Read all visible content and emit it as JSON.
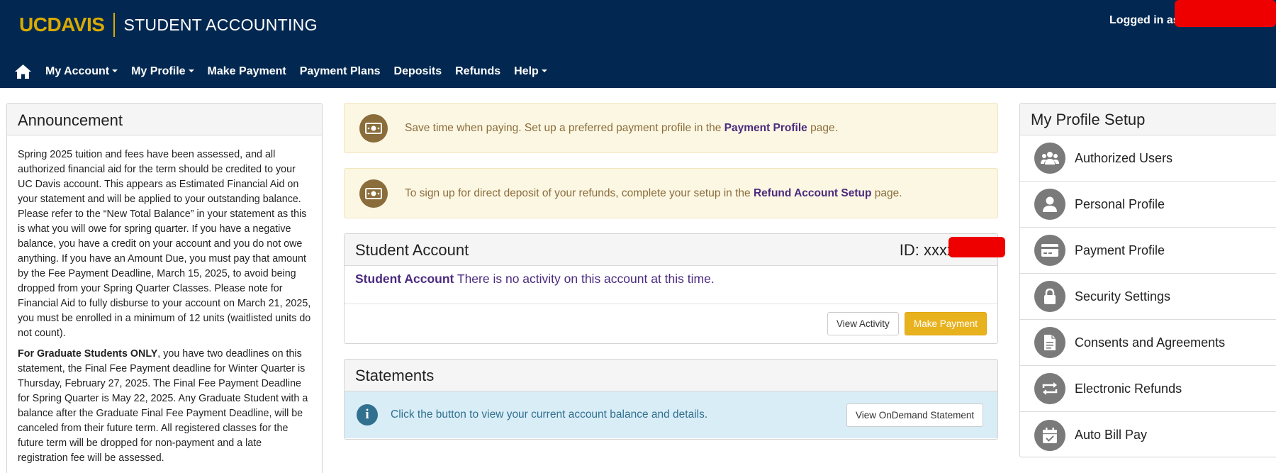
{
  "header": {
    "logo_text": "UCDAVIS",
    "app_title": "STUDENT ACCOUNTING",
    "login_text": "Logged in as"
  },
  "nav": {
    "items": [
      {
        "label": "My Account",
        "dropdown": true
      },
      {
        "label": "My Profile",
        "dropdown": true
      },
      {
        "label": "Make Payment",
        "dropdown": false
      },
      {
        "label": "Payment Plans",
        "dropdown": false
      },
      {
        "label": "Deposits",
        "dropdown": false
      },
      {
        "label": "Refunds",
        "dropdown": false
      },
      {
        "label": "Help",
        "dropdown": true
      }
    ]
  },
  "announcement": {
    "title": "Announcement",
    "p1": "Spring 2025 tuition and fees have been assessed, and all authorized financial aid for the term should be credited to your UC Davis account. This appears as Estimated Financial Aid on your statement and will be applied to your outstanding balance. Please refer to the “New Total Balance” in your statement as this is what you will owe for spring quarter. If you have a negative balance, you have a credit on your account and you do not owe anything. If you have an Amount Due, you must pay that amount by the Fee Payment Deadline, March 15, 2025, to avoid being dropped from your Spring Quarter Classes. Please note for Financial Aid to fully disburse to your account on March 21, 2025, you must be enrolled in a minimum of 12 units (waitlisted units do not count).",
    "p2_bold": "For Graduate Students ONLY",
    "p2_rest": ", you have two deadlines on this statement, the Final Fee Payment deadline for Winter Quarter is Thursday, February 27, 2025. The Final Fee Payment Deadline for Spring Quarter is May 22, 2025. Any Graduate Student with a balance after the Graduate Final Fee Payment Deadline, will be canceled from their future term. All registered classes for the future term will be dropped for non-payment and a late registration fee will be assessed."
  },
  "alerts": {
    "payment_profile": {
      "text_before": "Save time when paying. Set up a preferred payment profile in the ",
      "link": "Payment Profile",
      "text_after": " page."
    },
    "refund_setup": {
      "text_before": "To sign up for direct deposit of your refunds, complete your setup in the ",
      "link": "Refund Account Setup",
      "text_after": " page."
    }
  },
  "student_account": {
    "title": "Student Account",
    "id_label": "ID: xxxx",
    "line_bold": "Student Account",
    "line_text": " There is no activity on this account at this time.",
    "view_activity": "View Activity",
    "make_payment": "Make Payment"
  },
  "statements": {
    "title": "Statements",
    "info_text": "Click the button to view your current account balance and details.",
    "button": "View OnDemand Statement"
  },
  "profile_setup": {
    "title": "My Profile Setup",
    "items": [
      {
        "label": "Authorized Users",
        "icon": "users-icon"
      },
      {
        "label": "Personal Profile",
        "icon": "user-icon"
      },
      {
        "label": "Payment Profile",
        "icon": "credit-card-icon"
      },
      {
        "label": "Security Settings",
        "icon": "lock-icon"
      },
      {
        "label": "Consents and Agreements",
        "icon": "document-icon"
      },
      {
        "label": "Electronic Refunds",
        "icon": "refresh-arrows-icon"
      },
      {
        "label": "Auto Bill Pay",
        "icon": "calendar-check-icon"
      }
    ]
  },
  "colors": {
    "navy": "#022851",
    "gold": "#daaa00",
    "purple_link": "#4b2a7f",
    "warning_bg": "#fcf7e3",
    "info_bg": "#d9edf7",
    "redaction": "#ee0000"
  }
}
